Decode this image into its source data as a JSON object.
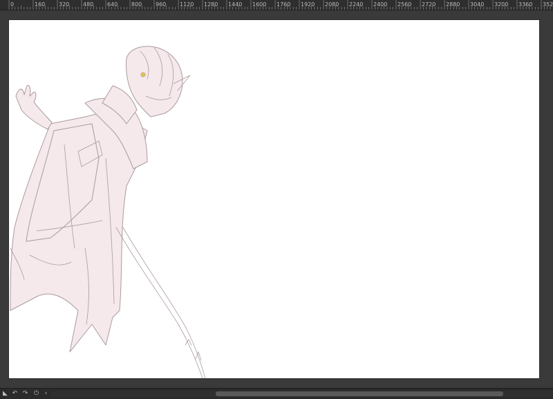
{
  "ruler": {
    "labels": [
      "0",
      "160",
      "320",
      "480",
      "640",
      "800",
      "960",
      "1120",
      "1280",
      "1440",
      "1600",
      "1760",
      "1920",
      "2080",
      "2240",
      "2400",
      "2560",
      "2720",
      "2880",
      "3040",
      "3200",
      "3360",
      "352"
    ]
  },
  "statusbar": {
    "buttons": [
      {
        "name": "panel-toggle-icon",
        "glyph": "◣"
      },
      {
        "name": "rotate-left-icon",
        "glyph": "↶"
      },
      {
        "name": "rotate-right-icon",
        "glyph": "↷"
      },
      {
        "name": "reset-rotation-icon",
        "glyph": "⏻"
      },
      {
        "name": "flip-icon",
        "glyph": "‹"
      }
    ]
  },
  "colors": {
    "sketch_line": "#a99a9d",
    "sketch_fill": "#f5e9ec",
    "eye": "#e2c34a"
  }
}
